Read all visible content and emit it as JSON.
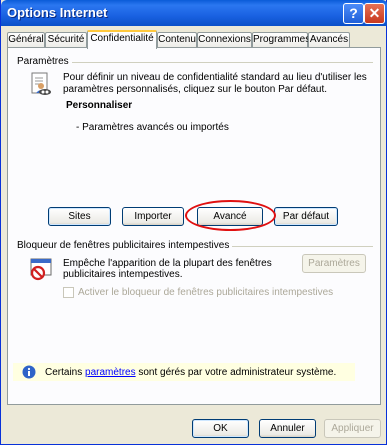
{
  "window": {
    "title": "Options Internet",
    "help_symbol": "?",
    "close_symbol": "✕"
  },
  "tabs": [
    {
      "label": "Général"
    },
    {
      "label": "Sécurité"
    },
    {
      "label": "Confidentialité",
      "active": true
    },
    {
      "label": "Contenu"
    },
    {
      "label": "Connexions"
    },
    {
      "label": "Programmes"
    },
    {
      "label": "Avancés"
    }
  ],
  "settings": {
    "group_label": "Paramètres",
    "description_line1": "Pour définir un niveau de confidentialité standard au lieu d'utiliser les",
    "description_line2": "paramètres personnalisés, cliquez sur le bouton Par défaut.",
    "level_title": "Personnaliser",
    "level_detail": "- Paramètres avancés ou importés",
    "buttons": {
      "sites": "Sites",
      "import": "Importer",
      "advanced": "Avancé",
      "default": "Par défaut"
    }
  },
  "popup_blocker": {
    "group_label": "Bloqueur de fenêtres publicitaires intempestives",
    "description_line1": "Empêche l'apparition de la plupart des fenêtres",
    "description_line2": "publicitaires intempestives.",
    "settings_button": "Paramètres",
    "checkbox_label": "Activer le bloqueur de fenêtres publicitaires intempestives",
    "checkbox_checked": false
  },
  "info": {
    "prefix": "Certains ",
    "link": "paramètres",
    "suffix": " sont gérés par votre administrateur système."
  },
  "footer": {
    "ok": "OK",
    "cancel": "Annuler",
    "apply": "Appliquer"
  },
  "colors": {
    "title_bar": "#0A5BD8",
    "highlight_ring": "#E01010",
    "info_background": "#FFFFE1"
  }
}
